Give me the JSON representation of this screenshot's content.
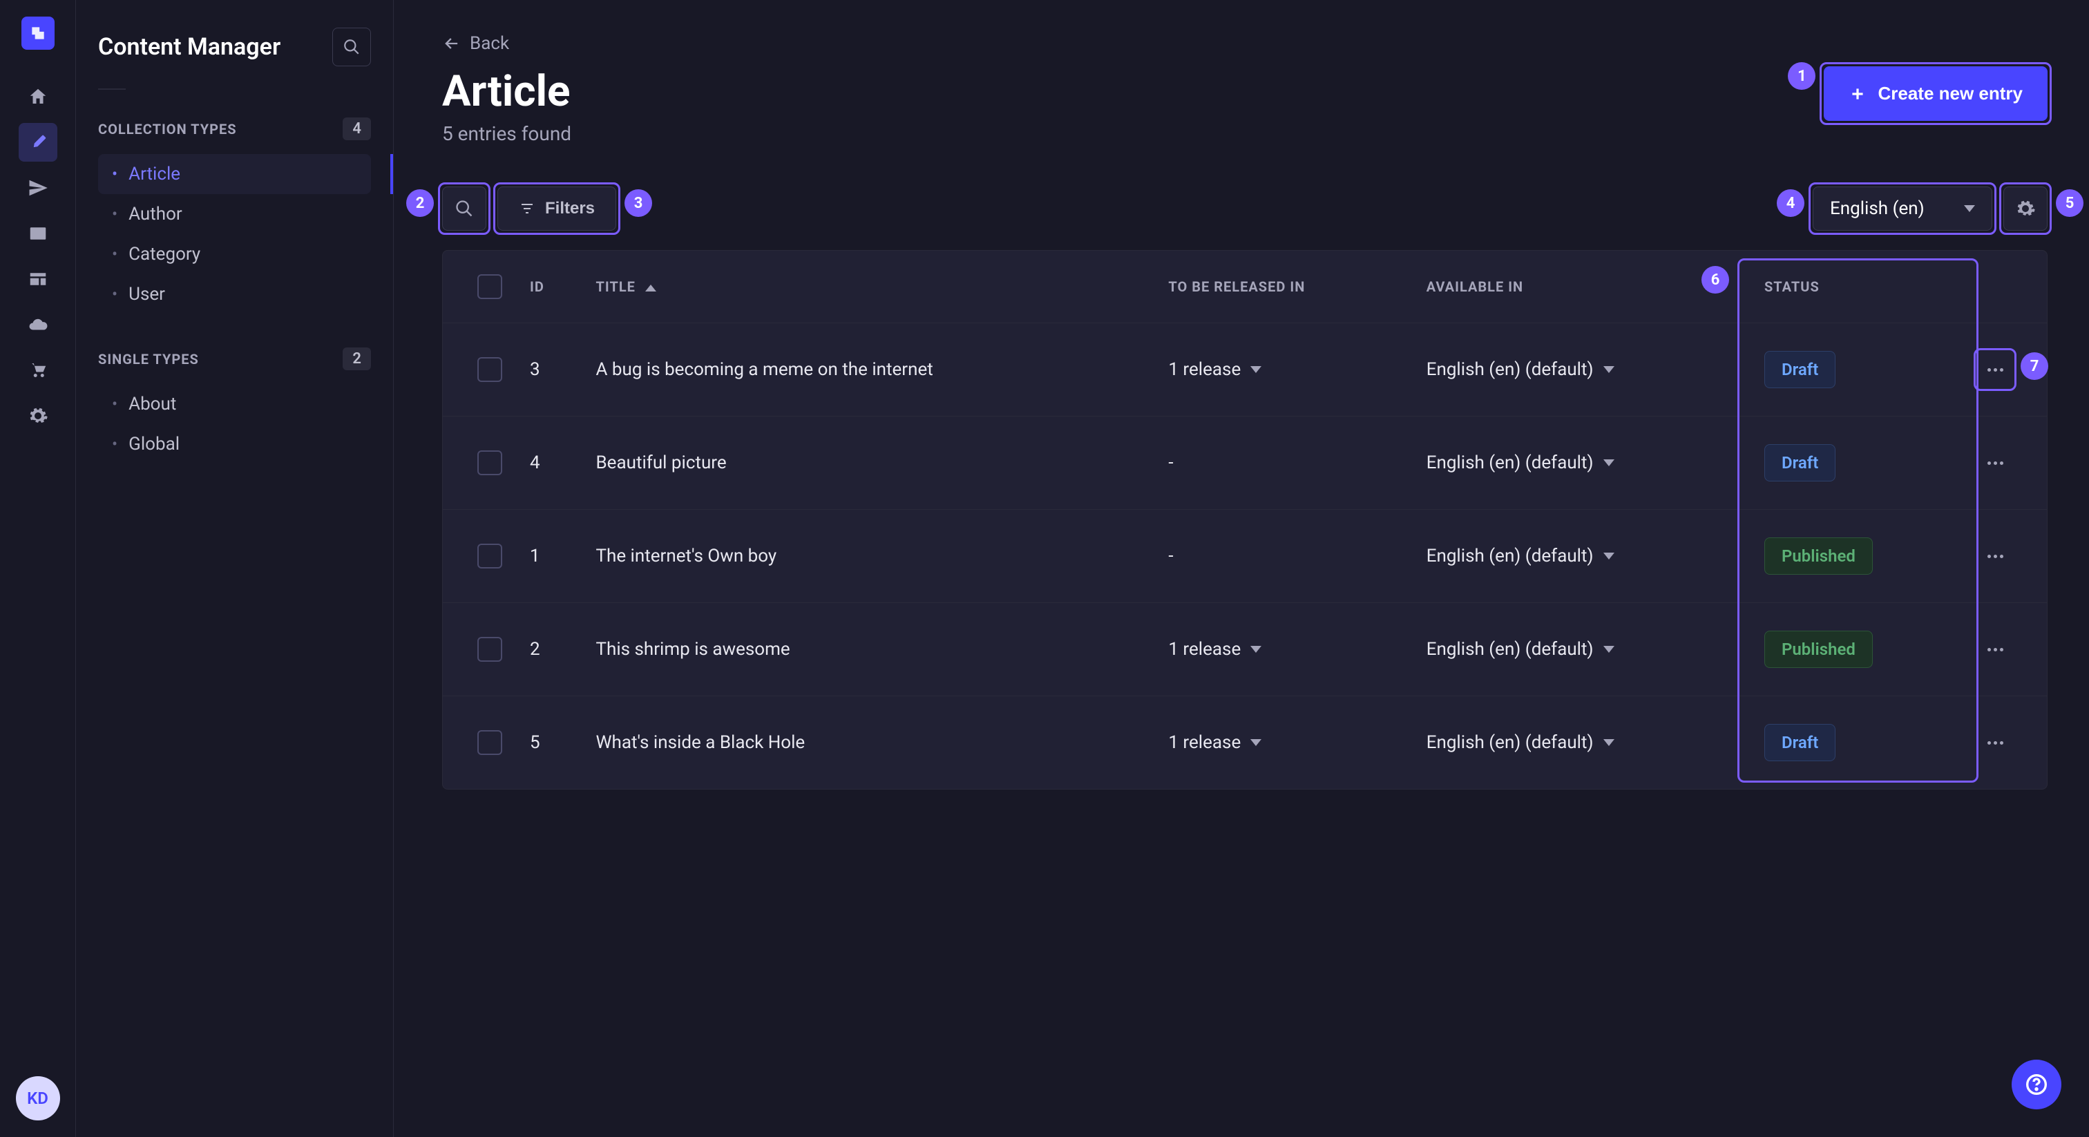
{
  "sidebar": {
    "title": "Content Manager",
    "collection_types_label": "Collection Types",
    "collection_types_count": "4",
    "collection_items": [
      {
        "label": "Article",
        "active": true
      },
      {
        "label": "Author",
        "active": false
      },
      {
        "label": "Category",
        "active": false
      },
      {
        "label": "User",
        "active": false
      }
    ],
    "single_types_label": "Single Types",
    "single_types_count": "2",
    "single_items": [
      {
        "label": "About"
      },
      {
        "label": "Global"
      }
    ]
  },
  "avatar": "KD",
  "back_label": "Back",
  "page": {
    "title": "Article",
    "subtitle": "5 entries found"
  },
  "create_button": "Create new entry",
  "filters_label": "Filters",
  "locale_selected": "English (en)",
  "columns": {
    "id": "ID",
    "title": "Title",
    "release": "To be released in",
    "available": "Available In",
    "status": "Status"
  },
  "rows": [
    {
      "id": "3",
      "title": "A bug is becoming a meme on the internet",
      "release": "1 release",
      "available": "English (en) (default)",
      "status": "Draft"
    },
    {
      "id": "4",
      "title": "Beautiful picture",
      "release": "-",
      "available": "English (en) (default)",
      "status": "Draft"
    },
    {
      "id": "1",
      "title": "The internet's Own boy",
      "release": "-",
      "available": "English (en) (default)",
      "status": "Published"
    },
    {
      "id": "2",
      "title": "This shrimp is awesome",
      "release": "1 release",
      "available": "English (en) (default)",
      "status": "Published"
    },
    {
      "id": "5",
      "title": "What's inside a Black Hole",
      "release": "1 release",
      "available": "English (en) (default)",
      "status": "Draft"
    }
  ],
  "highlights": {
    "create": "1",
    "search": "2",
    "filters": "3",
    "locale": "4",
    "settings": "5",
    "status_col": "6",
    "row_action": "7"
  }
}
